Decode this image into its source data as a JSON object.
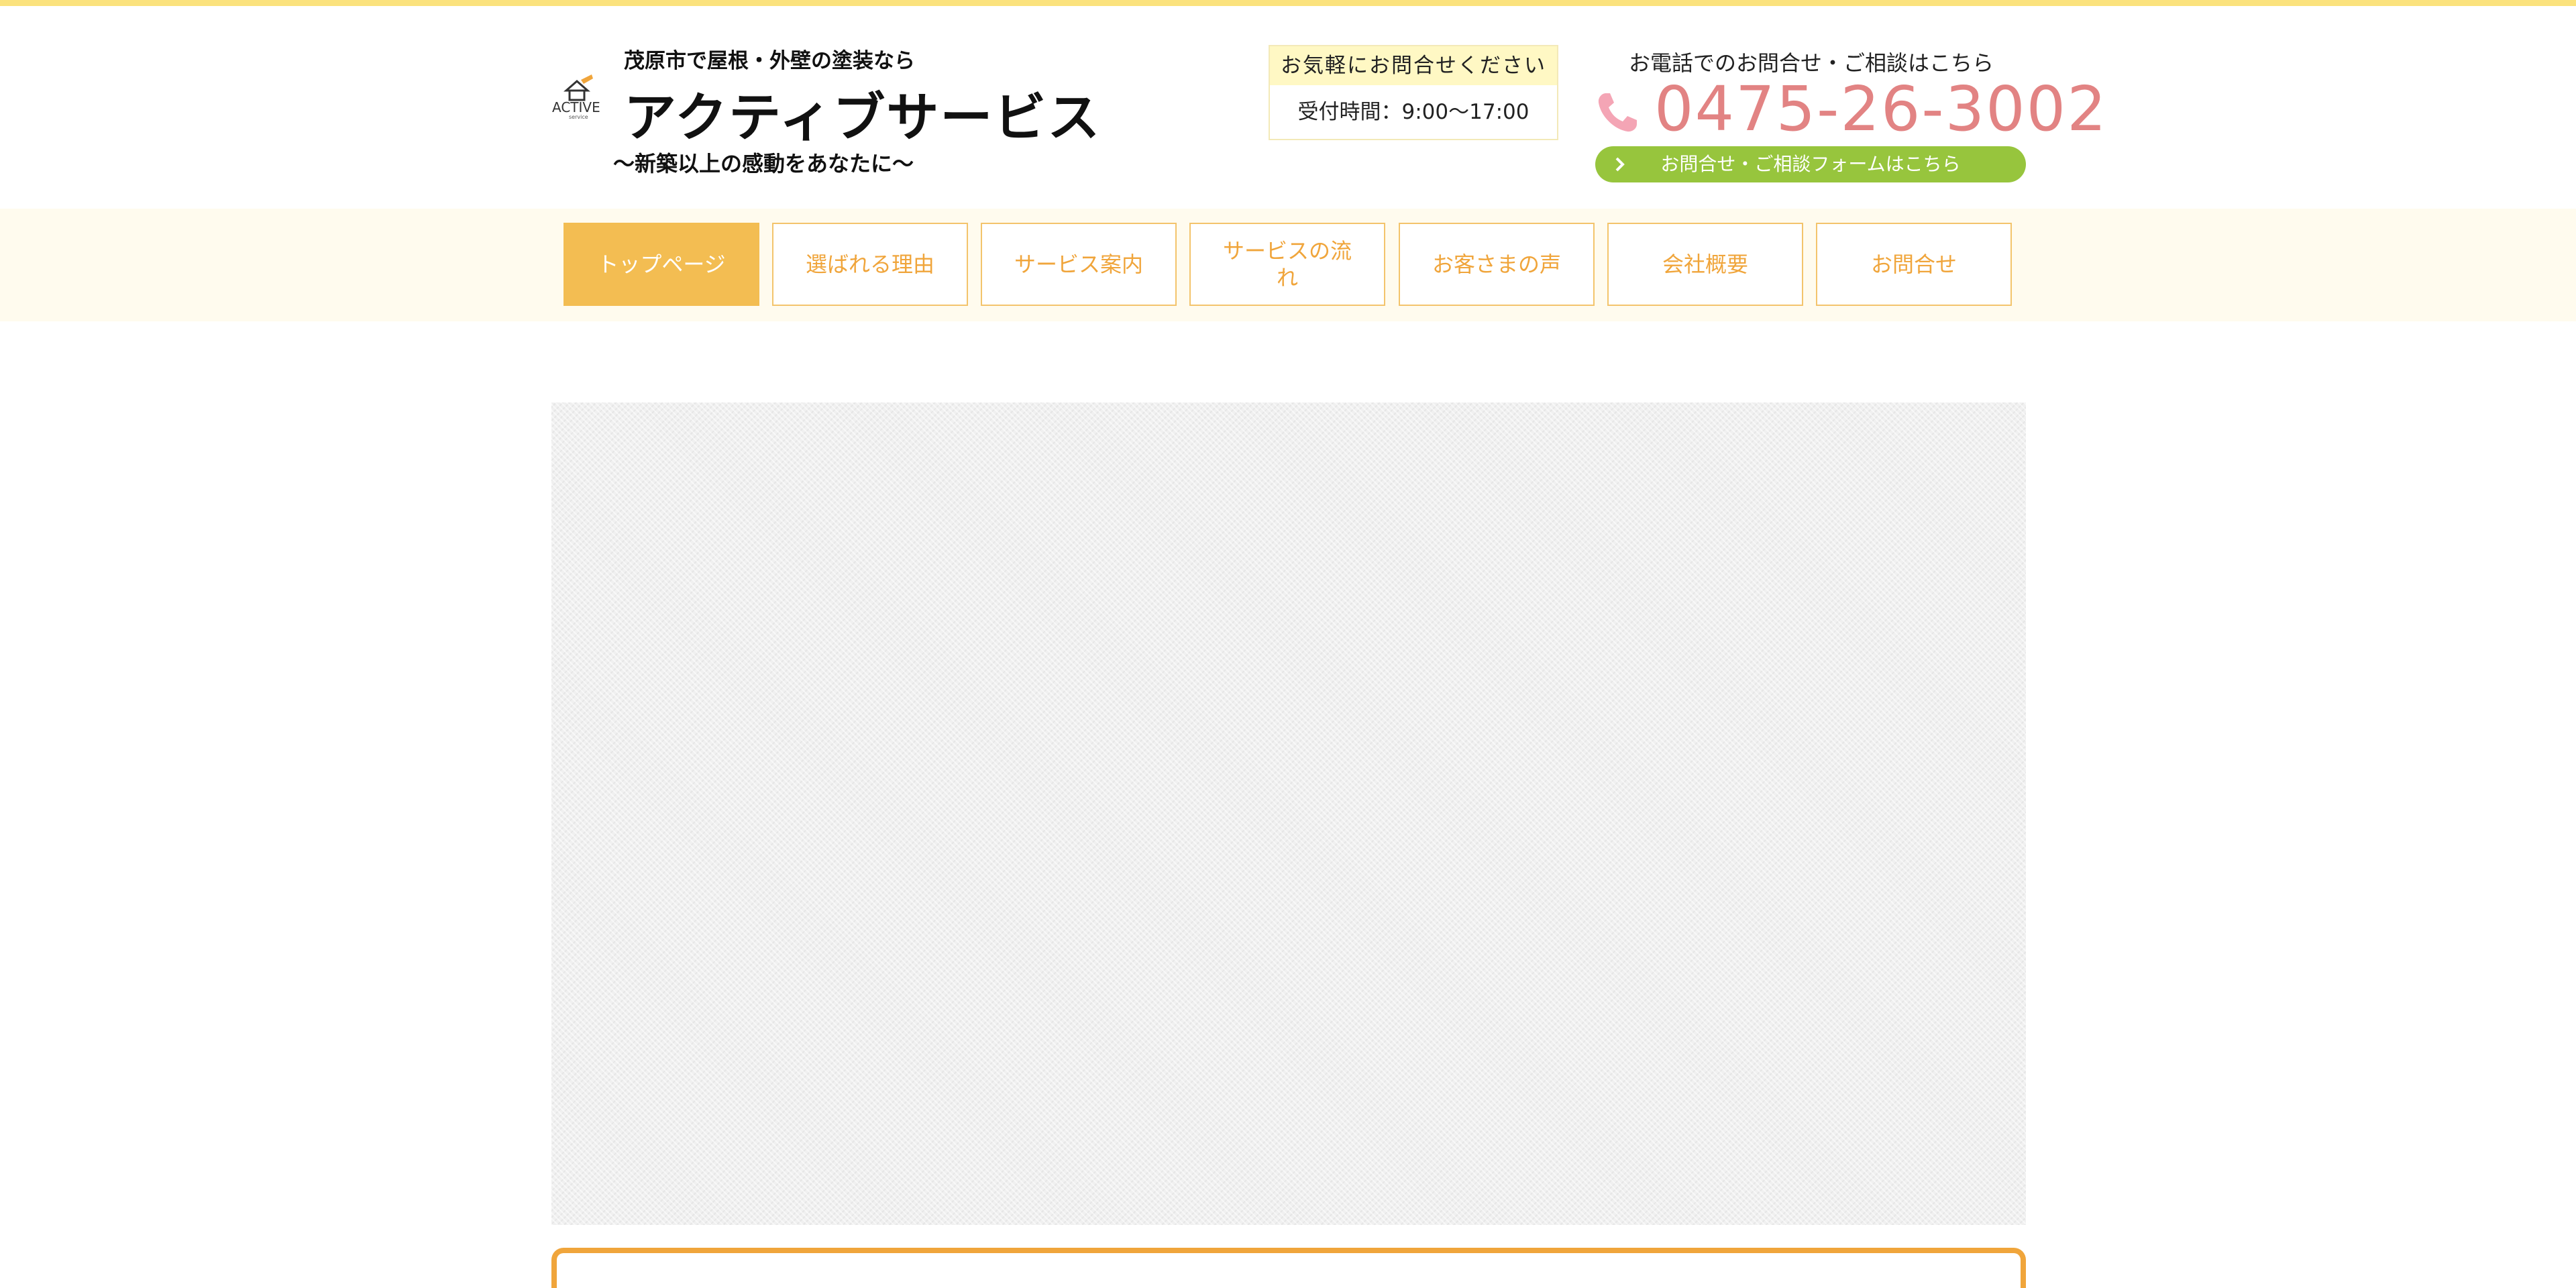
{
  "header": {
    "tagline": "茂原市で屋根・外壁の塗装なら",
    "site_name": "アクティブサービス",
    "catchphrase": "〜新築以上の感動をあなたに〜",
    "logo": {
      "text": "ACTIVE",
      "subtext": "service",
      "icon": "house-roof-icon"
    }
  },
  "hours": {
    "title": "お気軽にお問合せください",
    "text": "受付時間：9:00〜17:00"
  },
  "phone": {
    "caption": "お電話でのお問合せ・ご相談はこちら",
    "number": "0475-26-3002",
    "icon": "phone-icon"
  },
  "contact_button": {
    "label": "お問合せ・ご相談フォームはこちら",
    "icon": "chevron-right-icon"
  },
  "nav": {
    "items": [
      {
        "label": "トップページ",
        "active": true
      },
      {
        "label": "選ばれる理由",
        "active": false
      },
      {
        "label": "サービス案内",
        "active": false
      },
      {
        "label_line1": "サービスの流",
        "label_line2": "れ",
        "active": false
      },
      {
        "label": "お客さまの声",
        "active": false
      },
      {
        "label": "会社概要",
        "active": false
      },
      {
        "label": "お問合せ",
        "active": false
      }
    ]
  },
  "colors": {
    "top_stripe": "#fbe27d",
    "nav_band": "#fffbee",
    "nav_active": "#f3bd52",
    "nav_text": "#f0a53b",
    "phone_number": "#e28383",
    "phone_icon": "#f4a5b5",
    "contact_button": "#97c53d",
    "content_box_border": "#f0a53b"
  }
}
